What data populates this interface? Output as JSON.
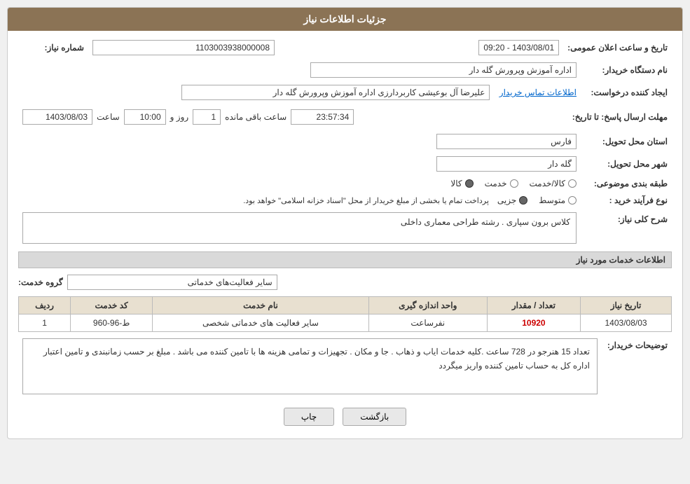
{
  "header": {
    "title": "جزئیات اطلاعات نیاز"
  },
  "fields": {
    "need_number_label": "شماره نیاز:",
    "need_number_value": "1103003938000008",
    "org_name_label": "نام دستگاه خریدار:",
    "org_name_value": "اداره آموزش وپرورش گله دار",
    "creator_label": "ایجاد کننده درخواست:",
    "creator_value": "علیرضا آل بوعیشی کاربردارزی اداره آموزش وپرورش گله دار",
    "creator_link": "اطلاعات تماس خریدار",
    "reply_deadline_label": "مهلت ارسال پاسخ: تا تاریخ:",
    "reply_date_value": "1403/08/03",
    "reply_time_label": "ساعت",
    "reply_time_value": "10:00",
    "reply_days_label": "روز و",
    "reply_days_value": "1",
    "reply_remaining_label": "ساعت باقی مانده",
    "reply_remaining_value": "23:57:34",
    "announce_label": "تاریخ و ساعت اعلان عمومی:",
    "announce_value": "1403/08/01 - 09:20",
    "province_label": "استان محل تحویل:",
    "province_value": "فارس",
    "city_label": "شهر محل تحویل:",
    "city_value": "گله دار",
    "category_label": "طبقه بندی موضوعی:",
    "category_options": [
      "کالا",
      "خدمت",
      "کالا/خدمت"
    ],
    "category_selected": "کالا",
    "process_label": "نوع فرآیند خرید :",
    "process_options": [
      "جزیی",
      "متوسط"
    ],
    "process_note": "پرداخت تمام یا بخشی از مبلغ خریدار از محل \"اسناد خزانه اسلامی\" خواهد بود.",
    "need_desc_label": "شرح کلی نیاز:",
    "need_desc_value": "کلاس برون سپاری . رشته طراحی معماری داخلی"
  },
  "services_section": {
    "title": "اطلاعات خدمات مورد نیاز",
    "group_label": "گروه خدمت:",
    "group_value": "سایر فعالیت‌های خدماتی",
    "table_headers": [
      "ردیف",
      "کد خدمت",
      "نام خدمت",
      "واحد اندازه گیری",
      "تعداد / مقدار",
      "تاریخ نیاز"
    ],
    "table_rows": [
      {
        "row": "1",
        "code": "ط-96-960",
        "name": "سایر فعالیت های خدماتی شخصی",
        "unit": "نفرساعت",
        "quantity": "10920",
        "date": "1403/08/03"
      }
    ]
  },
  "buyer_desc_label": "توضیحات خریدار:",
  "buyer_desc_value": "تعداد 15 هنرجو در 728 ساعت .کلیه خدمات ایاب و ذهاب . جا و مکان . تجهیزات و تمامی هزینه ها با تامین کننده می باشد . مبلغ بر حسب زمانبندی و تامین اعتبار اداره کل  به حساب تامین کننده واریز میگردد",
  "buttons": {
    "print": "چاپ",
    "back": "بازگشت"
  }
}
